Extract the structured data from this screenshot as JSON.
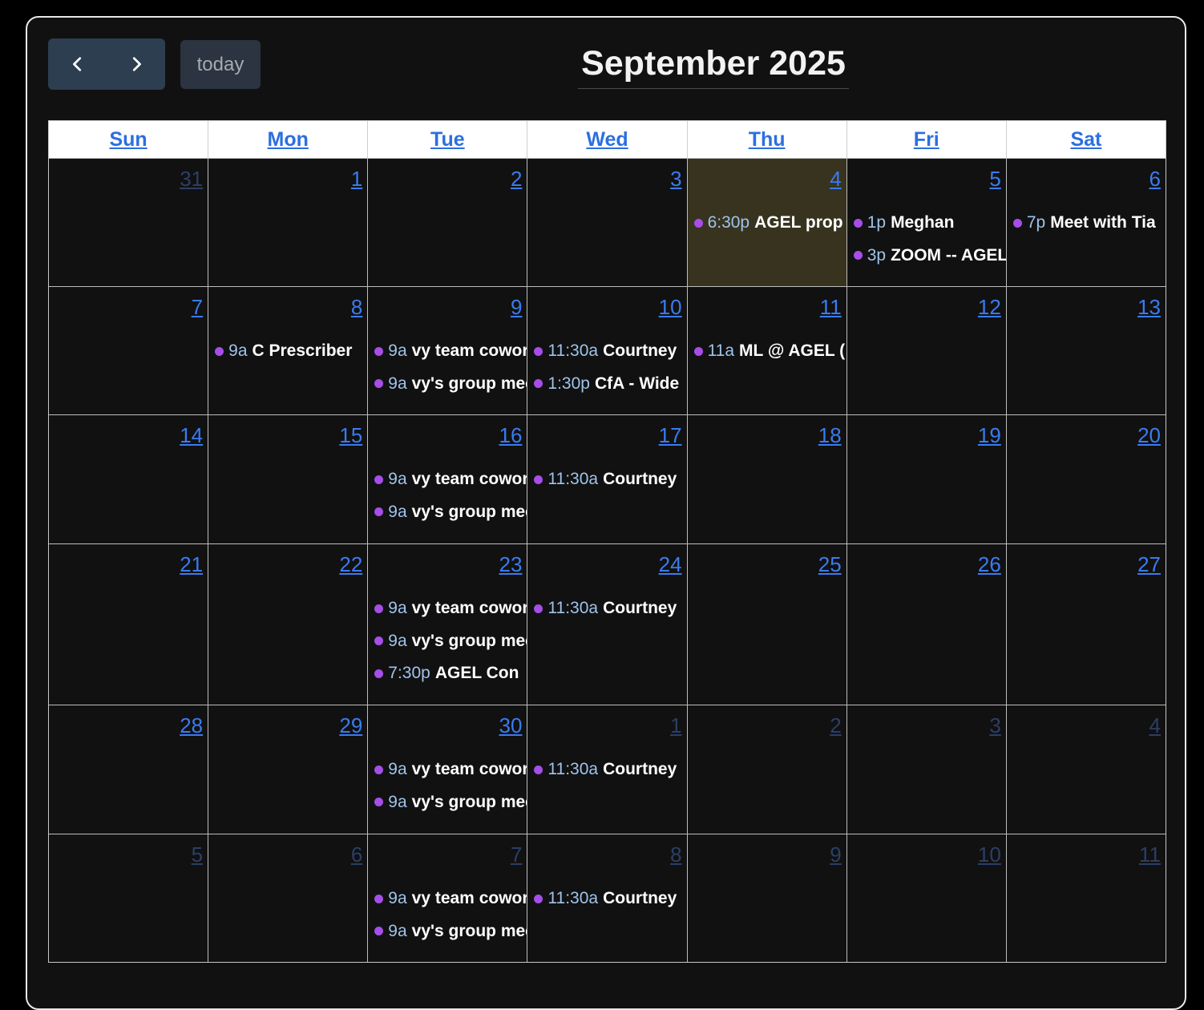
{
  "toolbar": {
    "prev_icon": "chevron-left-icon",
    "next_icon": "chevron-right-icon",
    "today_label": "today",
    "title": "September 2025"
  },
  "weekdays": [
    "Sun",
    "Mon",
    "Tue",
    "Wed",
    "Thu",
    "Fri",
    "Sat"
  ],
  "colors": {
    "event_dot": "#a64ee8",
    "today_bg": "#37331f",
    "link": "#3a7cf0"
  },
  "weeks": [
    [
      {
        "num": "31",
        "other": true,
        "events": []
      },
      {
        "num": "1",
        "events": []
      },
      {
        "num": "2",
        "events": []
      },
      {
        "num": "3",
        "events": []
      },
      {
        "num": "4",
        "today": true,
        "events": [
          {
            "time": "6:30p",
            "title": "AGEL prop"
          }
        ]
      },
      {
        "num": "5",
        "events": [
          {
            "time": "1p",
            "title": "Meghan"
          },
          {
            "time": "3p",
            "title": "ZOOM -- AGEL"
          }
        ]
      },
      {
        "num": "6",
        "events": [
          {
            "time": "7p",
            "title": "Meet with Tia"
          }
        ]
      }
    ],
    [
      {
        "num": "7",
        "events": []
      },
      {
        "num": "8",
        "events": [
          {
            "time": "9a",
            "title": "C Prescriber"
          }
        ]
      },
      {
        "num": "9",
        "events": [
          {
            "time": "9a",
            "title": "vy team cowork"
          },
          {
            "time": "9a",
            "title": "vy's group meeting"
          }
        ]
      },
      {
        "num": "10",
        "events": [
          {
            "time": "11:30a",
            "title": "Courtney"
          },
          {
            "time": "1:30p",
            "title": "CfA - Wide"
          }
        ]
      },
      {
        "num": "11",
        "events": [
          {
            "time": "11a",
            "title": "ML @ AGEL ("
          }
        ]
      },
      {
        "num": "12",
        "events": []
      },
      {
        "num": "13",
        "events": []
      }
    ],
    [
      {
        "num": "14",
        "events": []
      },
      {
        "num": "15",
        "events": []
      },
      {
        "num": "16",
        "events": [
          {
            "time": "9a",
            "title": "vy team cowork"
          },
          {
            "time": "9a",
            "title": "vy's group meeting"
          }
        ]
      },
      {
        "num": "17",
        "events": [
          {
            "time": "11:30a",
            "title": "Courtney"
          }
        ]
      },
      {
        "num": "18",
        "events": []
      },
      {
        "num": "19",
        "events": []
      },
      {
        "num": "20",
        "events": []
      }
    ],
    [
      {
        "num": "21",
        "events": []
      },
      {
        "num": "22",
        "events": []
      },
      {
        "num": "23",
        "events": [
          {
            "time": "9a",
            "title": "vy team cowork"
          },
          {
            "time": "9a",
            "title": "vy's group meeting"
          },
          {
            "time": "7:30p",
            "title": "AGEL Con"
          }
        ]
      },
      {
        "num": "24",
        "events": [
          {
            "time": "11:30a",
            "title": "Courtney"
          }
        ]
      },
      {
        "num": "25",
        "events": []
      },
      {
        "num": "26",
        "events": []
      },
      {
        "num": "27",
        "events": []
      }
    ],
    [
      {
        "num": "28",
        "events": []
      },
      {
        "num": "29",
        "events": []
      },
      {
        "num": "30",
        "events": [
          {
            "time": "9a",
            "title": "vy team cowork"
          },
          {
            "time": "9a",
            "title": "vy's group meeting"
          }
        ]
      },
      {
        "num": "1",
        "other": true,
        "events": [
          {
            "time": "11:30a",
            "title": "Courtney"
          }
        ]
      },
      {
        "num": "2",
        "other": true,
        "events": []
      },
      {
        "num": "3",
        "other": true,
        "events": []
      },
      {
        "num": "4",
        "other": true,
        "events": []
      }
    ],
    [
      {
        "num": "5",
        "other": true,
        "events": []
      },
      {
        "num": "6",
        "other": true,
        "events": []
      },
      {
        "num": "7",
        "other": true,
        "events": [
          {
            "time": "9a",
            "title": "vy team cowork"
          },
          {
            "time": "9a",
            "title": "vy's group meeting"
          }
        ]
      },
      {
        "num": "8",
        "other": true,
        "events": [
          {
            "time": "11:30a",
            "title": "Courtney"
          }
        ]
      },
      {
        "num": "9",
        "other": true,
        "events": []
      },
      {
        "num": "10",
        "other": true,
        "events": []
      },
      {
        "num": "11",
        "other": true,
        "events": []
      }
    ]
  ]
}
